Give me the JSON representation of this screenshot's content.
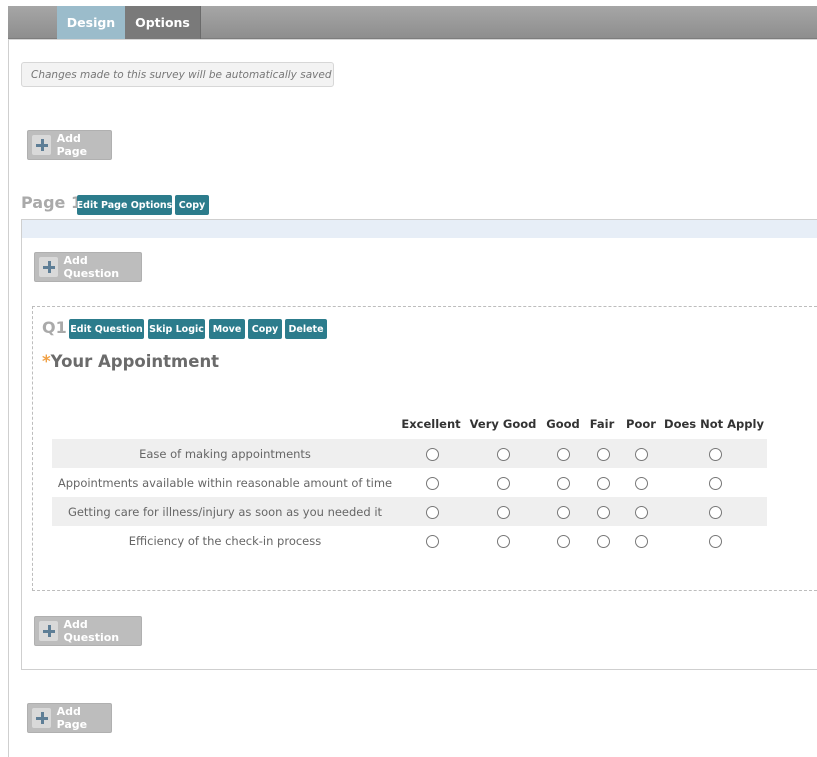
{
  "tabs": [
    {
      "label": "Design"
    },
    {
      "label": "Options"
    }
  ],
  "notice": "Changes made to this survey will be automatically saved",
  "add_page_label": "Add Page",
  "add_question_label": "Add Question",
  "page": {
    "title": "Page 1",
    "buttons": [
      "Edit Page Options",
      "Copy"
    ]
  },
  "question": {
    "number": "Q1",
    "buttons": [
      "Edit Question",
      "Skip Logic",
      "Move",
      "Copy",
      "Delete"
    ],
    "required_mark": "*",
    "title": "Your Appointment",
    "columns": [
      "Excellent",
      "Very Good",
      "Good",
      "Fair",
      "Poor",
      "Does Not Apply"
    ],
    "rows": [
      "Ease of making appointments",
      "Appointments available within reasonable amount of time",
      "Getting care for illness/injury as soon as you needed it",
      "Efficiency of the check-in process"
    ]
  },
  "colors": {
    "tab_active": "#9bbccb",
    "tab_inactive": "#7a7a7a",
    "action_button": "#2c7c8c",
    "required_mark": "#f0a044"
  }
}
